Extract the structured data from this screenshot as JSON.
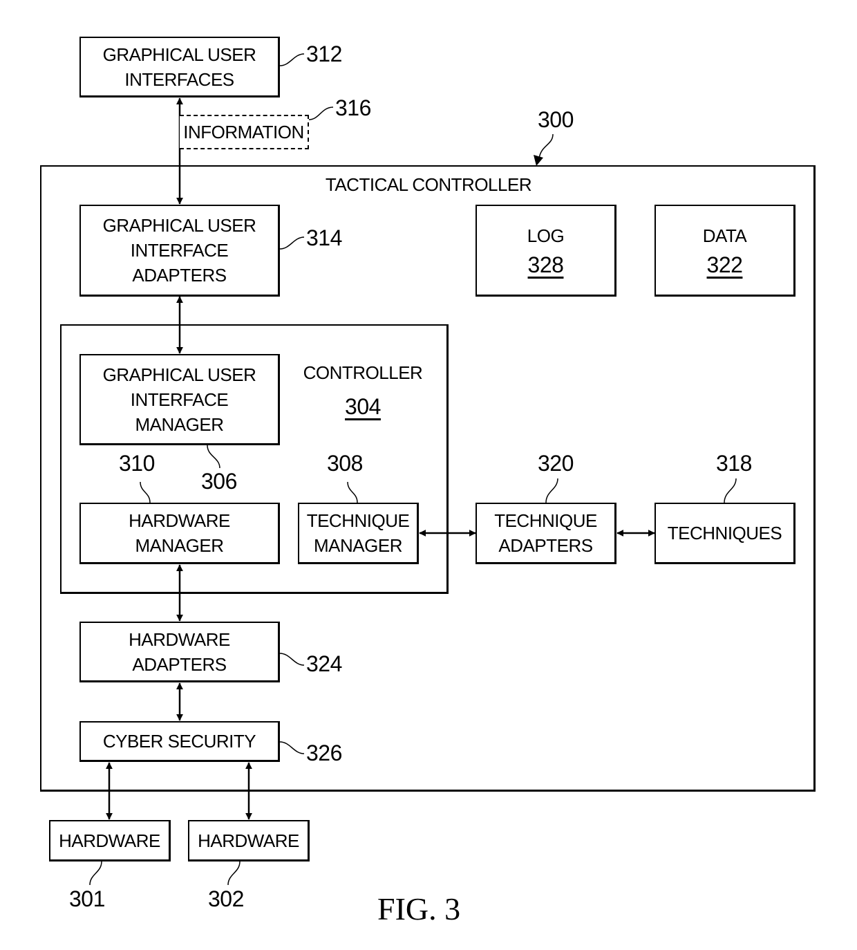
{
  "figure_label": "FIG. 3",
  "tactical_controller": {
    "title": "TACTICAL CONTROLLER",
    "ref": "300"
  },
  "controller": {
    "title": "CONTROLLER",
    "ref": "304"
  },
  "blocks": {
    "gui": {
      "lines": [
        "GRAPHICAL USER",
        "INTERFACES"
      ],
      "ref": "312"
    },
    "information": {
      "label": "INFORMATION",
      "ref": "316"
    },
    "gui_adapters": {
      "lines": [
        "GRAPHICAL USER",
        "INTERFACE",
        "ADAPTERS"
      ],
      "ref": "314"
    },
    "log": {
      "label": "LOG",
      "ref": "328"
    },
    "data": {
      "label": "DATA",
      "ref": "322"
    },
    "gui_manager": {
      "lines": [
        "GRAPHICAL USER",
        "INTERFACE",
        "MANAGER"
      ],
      "ref": "306"
    },
    "hardware_manager": {
      "lines": [
        "HARDWARE",
        "MANAGER"
      ],
      "ref": "310"
    },
    "technique_manager": {
      "lines": [
        "TECHNIQUE",
        "MANAGER"
      ],
      "ref": "308"
    },
    "technique_adapters": {
      "lines": [
        "TECHNIQUE",
        "ADAPTERS"
      ],
      "ref": "320"
    },
    "techniques": {
      "label": "TECHNIQUES",
      "ref": "318"
    },
    "hardware_adapters": {
      "lines": [
        "HARDWARE",
        "ADAPTERS"
      ],
      "ref": "324"
    },
    "cyber_security": {
      "label": "CYBER SECURITY",
      "ref": "326"
    },
    "hardware_1": {
      "label": "HARDWARE",
      "ref": "301"
    },
    "hardware_2": {
      "label": "HARDWARE",
      "ref": "302"
    }
  }
}
